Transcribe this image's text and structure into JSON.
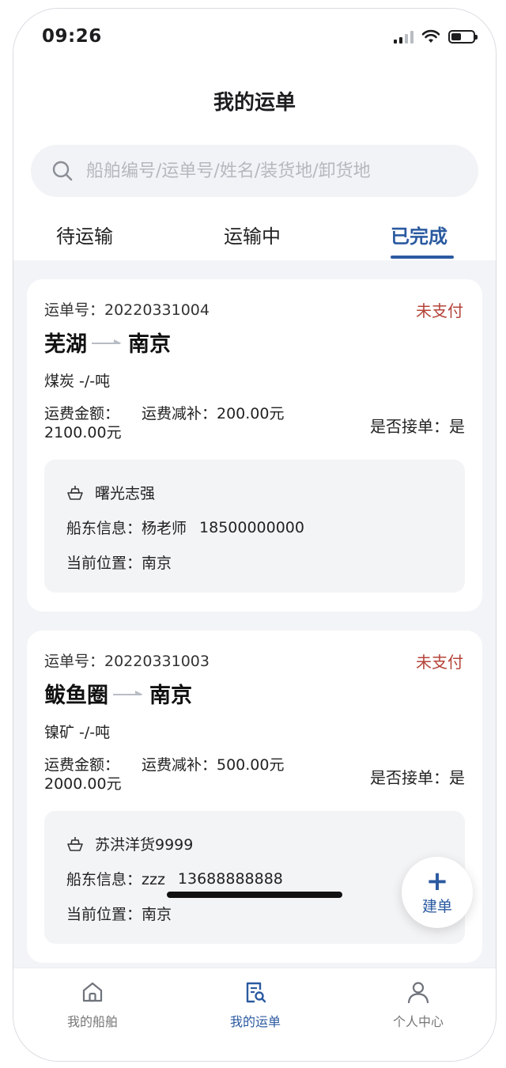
{
  "status_bar": {
    "time": "09:26",
    "battery_level": 0.45
  },
  "header": {
    "title": "我的运单"
  },
  "search": {
    "placeholder": "船舶编号/运单号/姓名/装货地/卸货地",
    "value": ""
  },
  "tabs": [
    {
      "label": "待运输",
      "active": false
    },
    {
      "label": "运输中",
      "active": false
    },
    {
      "label": "已完成",
      "active": true
    }
  ],
  "orders": [
    {
      "order_no_label": "运单号：20220331004",
      "status": "未支付",
      "from": "芜湖",
      "to": "南京",
      "cargo": "煤炭 -/-吨",
      "fee_amount": "运费金额：2100.00元",
      "fee_subsidy": "运费减补：200.00元",
      "accept": "是否接单：是",
      "ship_name": "曙光志强",
      "owner_info_label": "船东信息：杨老师",
      "owner_phone": "18500000000",
      "location": "当前位置：南京"
    },
    {
      "order_no_label": "运单号：20220331003",
      "status": "未支付",
      "from": "鲅鱼圈",
      "to": "南京",
      "cargo": "镍矿 -/-吨",
      "fee_amount": "运费金额：2000.00元",
      "fee_subsidy": "运费减补：500.00元",
      "accept": "是否接单：是",
      "ship_name": "苏洪洋货9999",
      "owner_info_label": "船东信息：zzz",
      "owner_phone": "13688888888",
      "location": "当前位置：南京"
    }
  ],
  "fab": {
    "plus": "+",
    "label": "建单"
  },
  "bottom_nav": [
    {
      "label": "我的船舶",
      "icon": "home-icon",
      "active": false
    },
    {
      "label": "我的运单",
      "icon": "waybill-search-icon",
      "active": true
    },
    {
      "label": "个人中心",
      "icon": "user-icon",
      "active": false
    }
  ],
  "colors": {
    "accent": "#2b5aa0",
    "unpaid": "#b4443a",
    "background": "#f3f4f7"
  }
}
